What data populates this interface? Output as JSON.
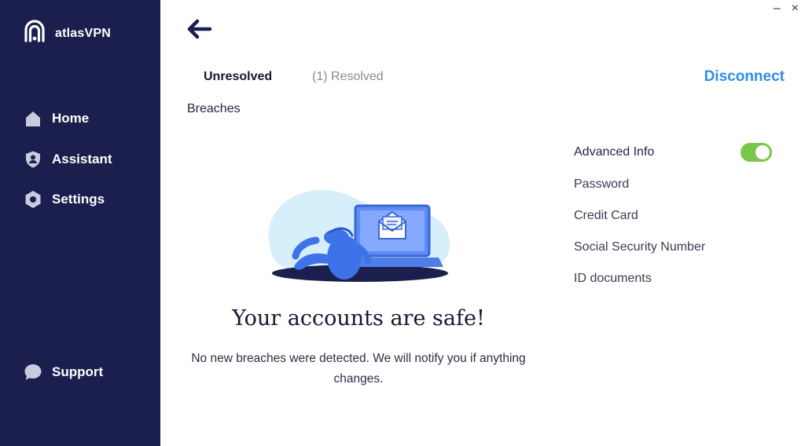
{
  "app": {
    "name": "atlasVPN"
  },
  "window": {
    "minimize": "–",
    "close": "×"
  },
  "sidebar": {
    "items": [
      {
        "label": "Home",
        "icon": "home-icon"
      },
      {
        "label": "Assistant",
        "icon": "shield-user-icon"
      },
      {
        "label": "Settings",
        "icon": "gear-icon"
      }
    ],
    "support": {
      "label": "Support",
      "icon": "chat-bubble-icon"
    }
  },
  "header": {
    "back_icon": "arrow-left-icon",
    "tabs": [
      {
        "label": "Unresolved",
        "active": true
      },
      {
        "label": "(1)  Resolved",
        "active": false
      }
    ],
    "disconnect_label": "Disconnect"
  },
  "main": {
    "section_label": "Breaches",
    "safe_title": "Your accounts are safe!",
    "safe_description": "No new breaches were detected. We will notify you if anything changes."
  },
  "panel": {
    "advanced_info": {
      "label": "Advanced Info",
      "enabled": true
    },
    "items": [
      "Password",
      "Credit Card",
      "Social Security Number",
      "ID documents"
    ]
  },
  "colors": {
    "sidebar_bg": "#1b1f4d",
    "accent": "#2f8ce8",
    "toggle_on": "#79c74a"
  }
}
